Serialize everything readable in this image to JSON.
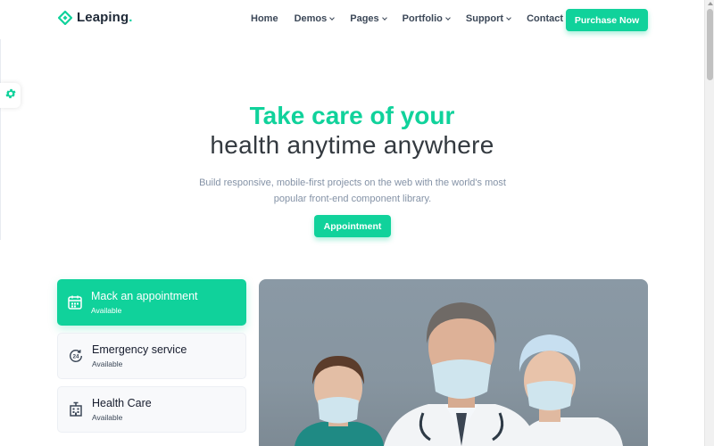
{
  "brand": {
    "name": "Leaping",
    "dot": ".",
    "accent": "#10d29b"
  },
  "nav": {
    "items": [
      {
        "label": "Home",
        "dropdown": false
      },
      {
        "label": "Demos",
        "dropdown": true
      },
      {
        "label": "Pages",
        "dropdown": true
      },
      {
        "label": "Portfolio",
        "dropdown": true
      },
      {
        "label": "Support",
        "dropdown": true
      },
      {
        "label": "Contact",
        "dropdown": false
      }
    ],
    "cta": "Purchase Now"
  },
  "hero": {
    "title_line1": "Take care of your",
    "title_line2": "health anytime anywhere",
    "subtitle": "Build responsive, mobile-first projects on the web with the world's most popular front-end component library.",
    "button": "Appointment"
  },
  "services": [
    {
      "title": "Mack an appointment",
      "status": "Available",
      "icon": "calendar-icon",
      "active": true
    },
    {
      "title": "Emergency service",
      "status": "Available",
      "icon": "24-hours-icon",
      "active": false
    },
    {
      "title": "Health Care",
      "status": "Available",
      "icon": "hospital-building-icon",
      "active": false
    }
  ],
  "photo": {
    "subject": "three medical professionals wearing face masks"
  },
  "settings_icon": "gear-icon"
}
